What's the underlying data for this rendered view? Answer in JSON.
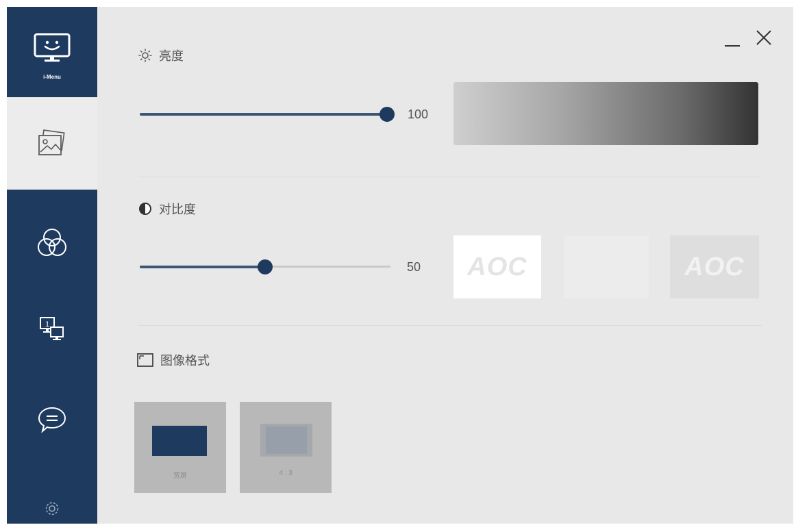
{
  "sidebar": {
    "logo_label": "i-Menu",
    "items": [
      {
        "icon": "image-setting-icon",
        "active": true
      },
      {
        "icon": "color-circles-icon",
        "active": false
      },
      {
        "icon": "multi-screen-icon",
        "active": false
      },
      {
        "icon": "chat-bubble-icon",
        "active": false
      },
      {
        "icon": "gear-icon",
        "active": false
      }
    ]
  },
  "window_controls": {
    "minimize": "minimize-icon",
    "close": "close-icon"
  },
  "brightness": {
    "title": "亮度",
    "value": "100",
    "fraction": 1.0
  },
  "contrast": {
    "title": "对比度",
    "value": "50",
    "fraction": 0.5,
    "presets": [
      {
        "label": "AOC",
        "style": "high"
      },
      {
        "label": "",
        "style": "low"
      },
      {
        "label": "AOC",
        "style": "medium"
      }
    ]
  },
  "image_format": {
    "title": "图像格式",
    "options": [
      {
        "label": "宽屏",
        "selected": true
      },
      {
        "label": "4 : 3",
        "selected": false
      }
    ]
  },
  "colors": {
    "sidebar": "#1e3a5f",
    "background": "#e8e8e8",
    "accent": "#1e3a5f"
  }
}
